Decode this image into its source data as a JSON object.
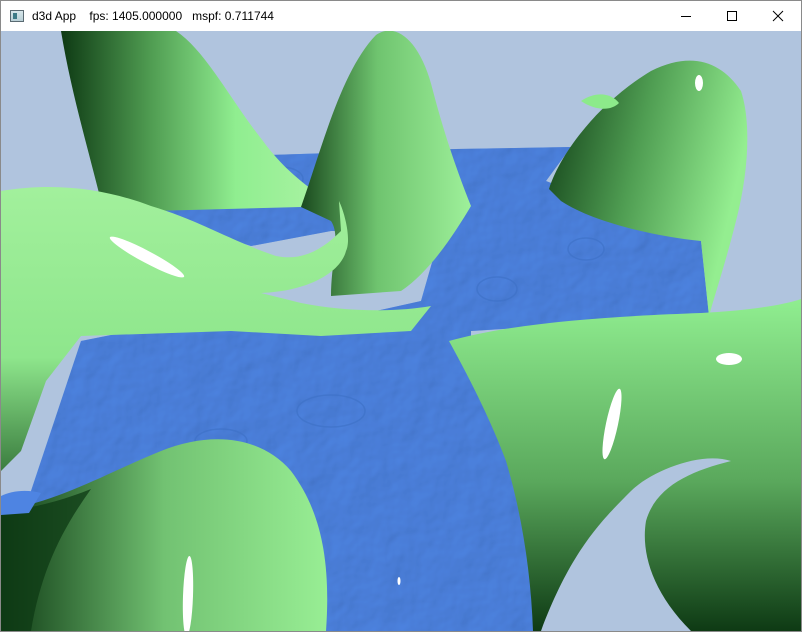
{
  "window": {
    "title": "d3d App    fps: 1405.000000   mspf: 0.711744"
  },
  "caption_buttons": {
    "minimize_icon": "minimize-icon",
    "maximize_icon": "maximize-icon",
    "close_icon": "close-icon"
  },
  "scene": {
    "background_color": "#B0C4DE",
    "water_color": "#4E84E2",
    "land_color": "#90EE90",
    "land_shadow_color": "#0E3A14",
    "highlight_color": "#FFFFFF"
  }
}
